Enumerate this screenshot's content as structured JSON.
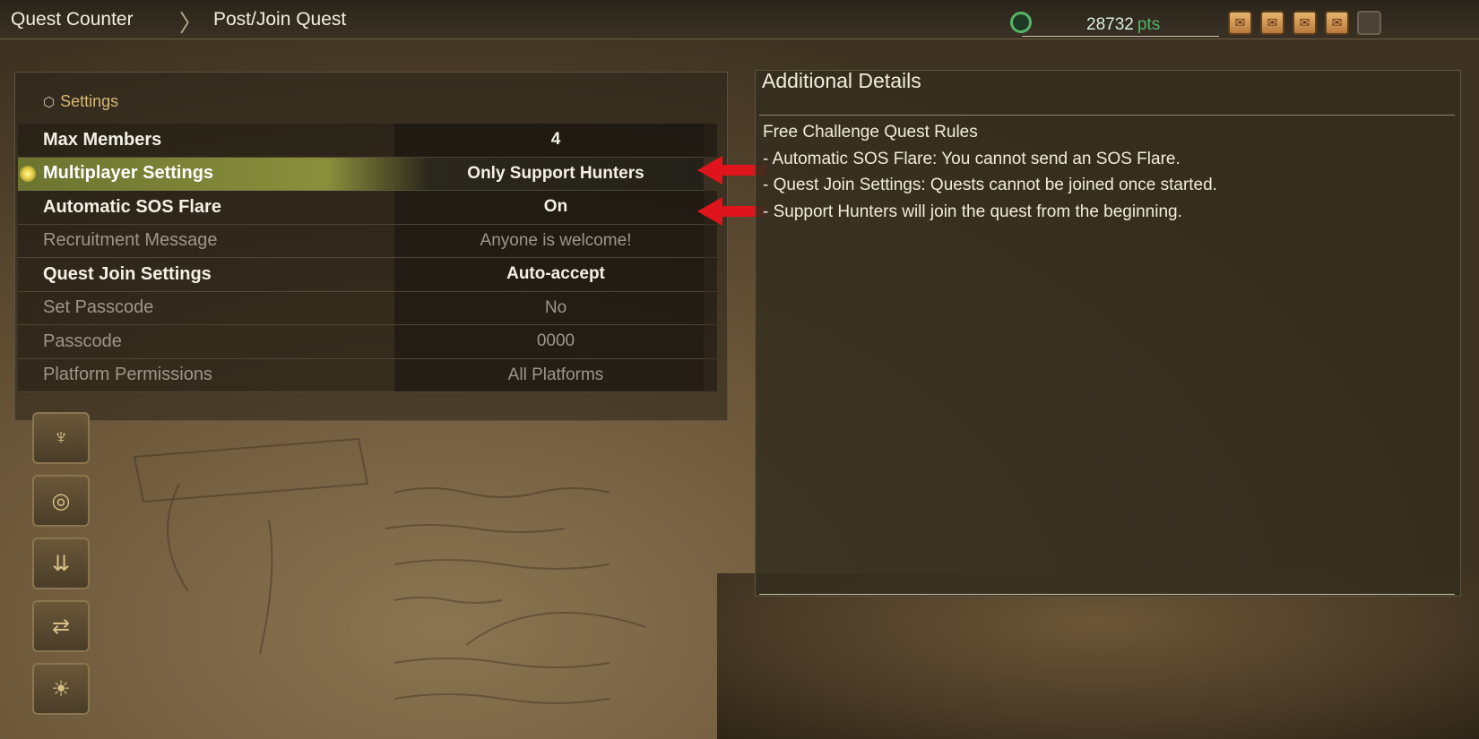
{
  "breadcrumb": {
    "items": [
      "Quest Counter",
      "Post/Join Quest"
    ],
    "separator": "〉"
  },
  "points": {
    "value": "28732",
    "unit": "pts"
  },
  "badges": [
    {
      "icon": "scroll-icon",
      "filled": true
    },
    {
      "icon": "scroll-icon",
      "filled": true
    },
    {
      "icon": "scroll-icon",
      "filled": true
    },
    {
      "icon": "scroll-icon",
      "filled": true
    },
    {
      "icon": "empty-slot-icon",
      "filled": false
    }
  ],
  "settings": {
    "title": "Settings",
    "rows": [
      {
        "label": "Max Members",
        "value": "4",
        "enabled": true,
        "selected": false
      },
      {
        "label": "Multiplayer Settings",
        "value": "Only Support Hunters",
        "enabled": true,
        "selected": true
      },
      {
        "label": "Automatic SOS Flare",
        "value": "On",
        "enabled": true,
        "selected": false
      },
      {
        "label": "Recruitment Message",
        "value": "Anyone is welcome!",
        "enabled": false,
        "selected": false
      },
      {
        "label": "Quest Join Settings",
        "value": "Auto-accept",
        "enabled": true,
        "selected": false
      },
      {
        "label": "Set Passcode",
        "value": "No",
        "enabled": false,
        "selected": false
      },
      {
        "label": "Passcode",
        "value": "0000",
        "enabled": false,
        "selected": false
      },
      {
        "label": "Platform Permissions",
        "value": "All Platforms",
        "enabled": false,
        "selected": false
      }
    ]
  },
  "details": {
    "title": "Additional Details",
    "lines": [
      "Free Challenge Quest Rules",
      "- Automatic SOS Flare: You cannot send an SOS Flare.",
      "- Quest Join Settings: Quests cannot be joined once started.",
      "- Support Hunters will join the quest from the beginning."
    ]
  },
  "side_menu": [
    {
      "icon": "monster-crest-icon"
    },
    {
      "icon": "compass-clock-icon"
    },
    {
      "icon": "arrows-down-icon"
    },
    {
      "icon": "scroll-swap-icon"
    },
    {
      "icon": "sun-icon"
    }
  ],
  "colors": {
    "accent_gold": "#d6b973",
    "selection_green": "#8a8f3c",
    "points_green": "#58b36a",
    "arrow_red": "#e0141c"
  }
}
